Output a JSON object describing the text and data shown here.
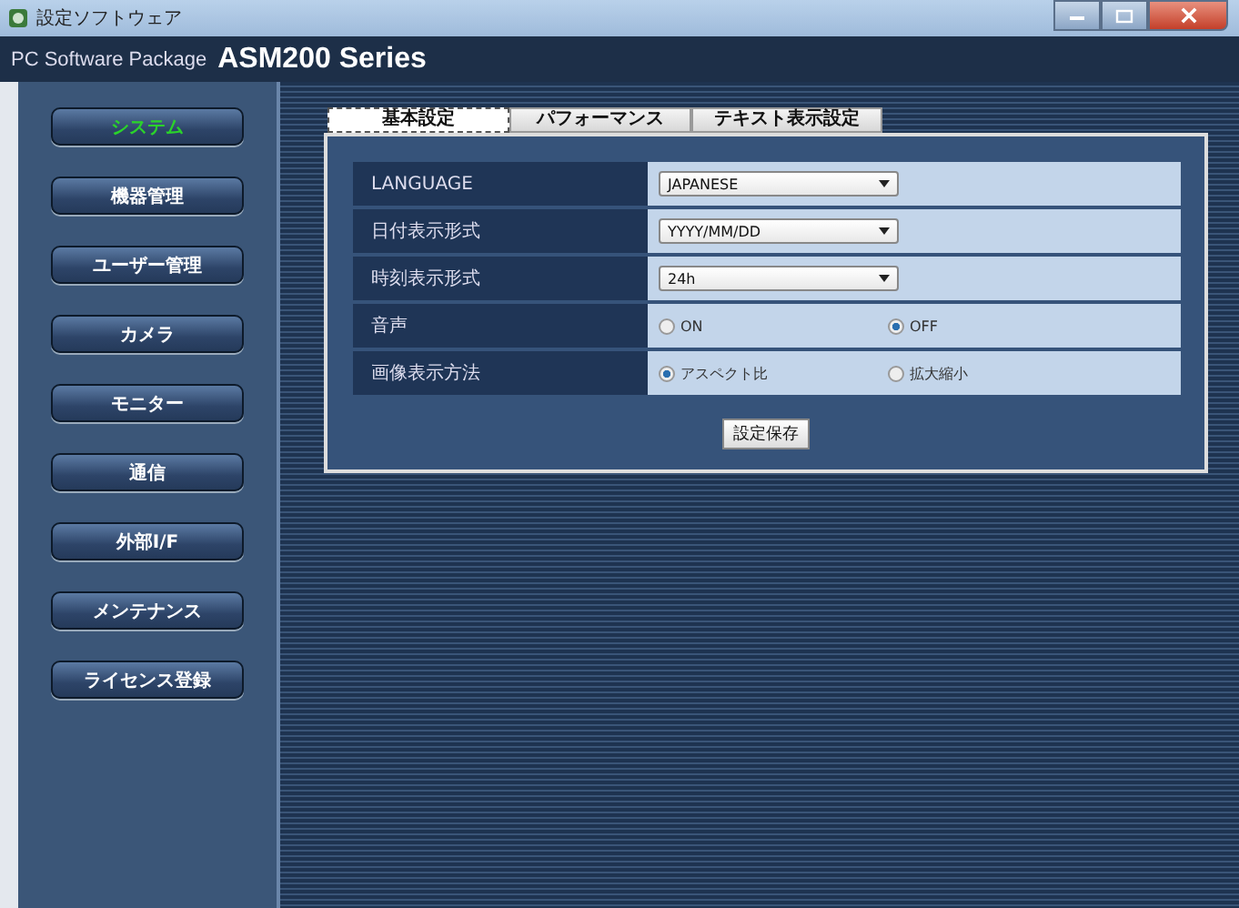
{
  "window": {
    "title": "設定ソフトウェア"
  },
  "header": {
    "subtitle": "PC Software Package",
    "product": "ASM200 Series"
  },
  "sidebar": {
    "items": [
      {
        "label": "システム",
        "selected": true
      },
      {
        "label": "機器管理",
        "selected": false
      },
      {
        "label": "ユーザー管理",
        "selected": false
      },
      {
        "label": "カメラ",
        "selected": false
      },
      {
        "label": "モニター",
        "selected": false
      },
      {
        "label": "通信",
        "selected": false
      },
      {
        "label": "外部I/F",
        "selected": false
      },
      {
        "label": "メンテナンス",
        "selected": false
      },
      {
        "label": "ライセンス登録",
        "selected": false
      }
    ]
  },
  "tabs": [
    {
      "label": "基本設定",
      "selected": true
    },
    {
      "label": "パフォーマンス",
      "selected": false
    },
    {
      "label": "テキスト表示設定",
      "selected": false
    }
  ],
  "settings": [
    {
      "kind": "select",
      "label": "LANGUAGE",
      "value": "JAPANESE"
    },
    {
      "kind": "select",
      "label": "日付表示形式",
      "value": "YYYY/MM/DD"
    },
    {
      "kind": "select",
      "label": "時刻表示形式",
      "value": "24h"
    },
    {
      "kind": "radio",
      "label": "音声",
      "options": [
        {
          "label": "ON",
          "selected": false
        },
        {
          "label": "OFF",
          "selected": true
        }
      ]
    },
    {
      "kind": "radio",
      "label": "画像表示方法",
      "options": [
        {
          "label": "アスペクト比",
          "selected": true
        },
        {
          "label": "拡大縮小",
          "selected": false
        }
      ]
    }
  ],
  "save_button": "設定保存"
}
